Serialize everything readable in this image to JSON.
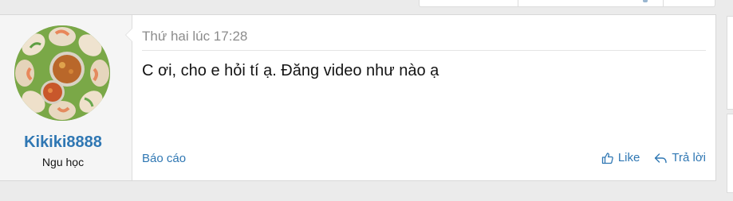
{
  "post": {
    "date": "Thứ hai lúc 17:28",
    "body": "C ơi, cho e hỏi tí ạ. Đăng video như nào ạ"
  },
  "user": {
    "name": "Kikiki8888",
    "title": "Ngu học",
    "avatar_icon": "avatar-spring-rolls-image"
  },
  "footer": {
    "report_label": "Báo cáo",
    "like_label": "Like",
    "reply_label": "Trả lời",
    "like_icon": "thumbs-up-icon",
    "reply_icon": "reply-arrow-icon"
  },
  "colors": {
    "link": "#2f77b3",
    "muted": "#8c8c8c",
    "background": "#ebebeb"
  }
}
